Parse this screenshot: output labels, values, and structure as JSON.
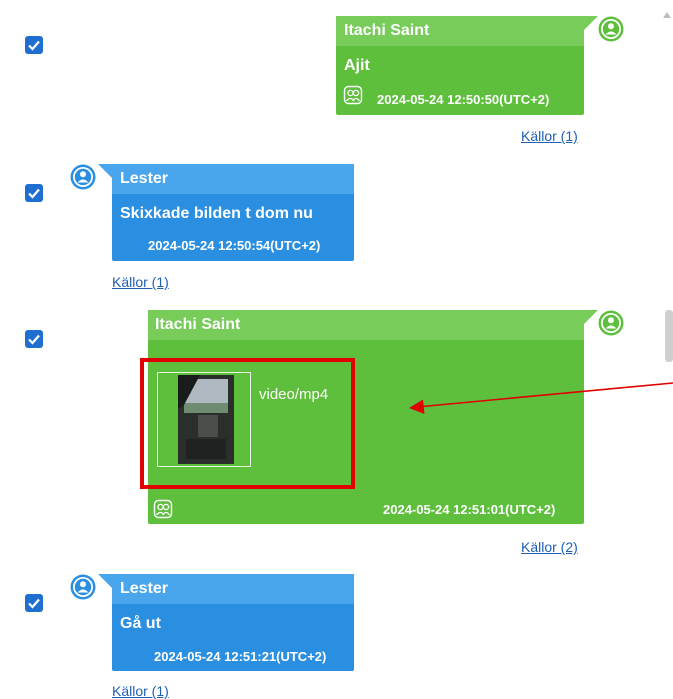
{
  "messages": [
    {
      "sender": "Itachi Saint",
      "text": "Ajit",
      "timestamp": "2024-05-24 12:50:50(UTC+2)",
      "sources": "Källor (1)",
      "direction": "outgoing",
      "selected": true
    },
    {
      "sender": "Lester",
      "text": "Skixkade bilden t dom nu",
      "timestamp": "2024-05-24 12:50:54(UTC+2)",
      "sources": "Källor (1)",
      "direction": "incoming",
      "selected": true
    },
    {
      "sender": "Itachi Saint",
      "attachment": {
        "type": "video/mp4",
        "thumbnail_icon": "video-thumbnail"
      },
      "timestamp": "2024-05-24 12:51:01(UTC+2)",
      "sources": "Källor (2)",
      "direction": "outgoing",
      "selected": true,
      "highlighted": true
    },
    {
      "sender": "Lester",
      "text": "Gå ut",
      "timestamp": "2024-05-24 12:51:21(UTC+2)",
      "sources": "Källor (1)",
      "direction": "incoming",
      "selected": true
    }
  ],
  "colors": {
    "outgoing_bubble": "#5ebf3c",
    "incoming_bubble": "#2a8fe0",
    "checkbox": "#1f6fd1",
    "highlight_box": "#e00000",
    "arrow": "#e00000",
    "link": "#1f5fb8"
  }
}
